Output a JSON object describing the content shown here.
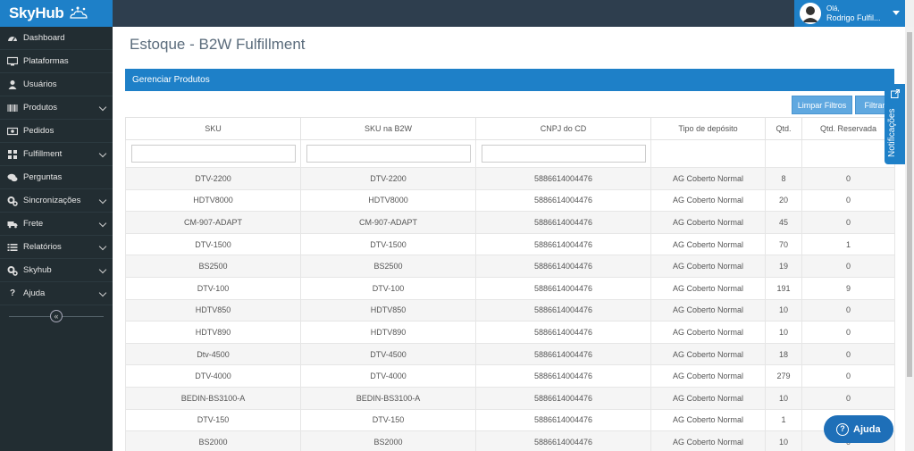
{
  "header": {
    "logo_text": "SkyHub",
    "user_greeting": "Olá,",
    "user_name": "Rodrigo Fulfil..."
  },
  "sidebar": {
    "items": [
      {
        "label": "Dashboard",
        "icon": "dashboard-icon",
        "has_submenu": false
      },
      {
        "label": "Plataformas",
        "icon": "monitor-icon",
        "has_submenu": false
      },
      {
        "label": "Usuários",
        "icon": "user-icon",
        "has_submenu": false
      },
      {
        "label": "Produtos",
        "icon": "barcode-icon",
        "has_submenu": true
      },
      {
        "label": "Pedidos",
        "icon": "money-icon",
        "has_submenu": false
      },
      {
        "label": "Fulfillment",
        "icon": "grid-icon",
        "has_submenu": true
      },
      {
        "label": "Perguntas",
        "icon": "comments-icon",
        "has_submenu": false
      },
      {
        "label": "Sincronizações",
        "icon": "cogs-icon",
        "has_submenu": true
      },
      {
        "label": "Frete",
        "icon": "truck-icon",
        "has_submenu": true
      },
      {
        "label": "Relatórios",
        "icon": "list-icon",
        "has_submenu": true
      },
      {
        "label": "Skyhub",
        "icon": "cogs-icon",
        "has_submenu": true
      },
      {
        "label": "Ajuda",
        "icon": "question-icon",
        "has_submenu": true
      }
    ]
  },
  "main": {
    "page_title": "Estoque - B2W Fulfillment",
    "panel_title": "Gerenciar Produtos",
    "buttons": {
      "clear_filters": "Limpar Filtros",
      "filter": "Filtrar"
    },
    "table": {
      "columns": [
        "SKU",
        "SKU na B2W",
        "CNPJ do CD",
        "Tipo de depósito",
        "Qtd.",
        "Qtd. Reservada"
      ],
      "rows": [
        [
          "DTV-2200",
          "DTV-2200",
          "5886614004476",
          "AG Coberto Normal",
          "8",
          "0"
        ],
        [
          "HDTV8000",
          "HDTV8000",
          "5886614004476",
          "AG Coberto Normal",
          "20",
          "0"
        ],
        [
          "CM-907-ADAPT",
          "CM-907-ADAPT",
          "5886614004476",
          "AG Coberto Normal",
          "45",
          "0"
        ],
        [
          "DTV-1500",
          "DTV-1500",
          "5886614004476",
          "AG Coberto Normal",
          "70",
          "1"
        ],
        [
          "BS2500",
          "BS2500",
          "5886614004476",
          "AG Coberto Normal",
          "19",
          "0"
        ],
        [
          "DTV-100",
          "DTV-100",
          "5886614004476",
          "AG Coberto Normal",
          "191",
          "9"
        ],
        [
          "HDTV850",
          "HDTV850",
          "5886614004476",
          "AG Coberto Normal",
          "10",
          "0"
        ],
        [
          "HDTV890",
          "HDTV890",
          "5886614004476",
          "AG Coberto Normal",
          "10",
          "0"
        ],
        [
          "Dtv-4500",
          "DTV-4500",
          "5886614004476",
          "AG Coberto Normal",
          "18",
          "0"
        ],
        [
          "DTV-4000",
          "DTV-4000",
          "5886614004476",
          "AG Coberto Normal",
          "279",
          "0"
        ],
        [
          "BEDIN-BS3100-A",
          "BEDIN-BS3100-A",
          "5886614004476",
          "AG Coberto Normal",
          "10",
          "0"
        ],
        [
          "DTV-150",
          "DTV-150",
          "5886614004476",
          "AG Coberto Normal",
          "1",
          ""
        ],
        [
          "BS2000",
          "BS2000",
          "5886614004476",
          "AG Coberto Normal",
          "10",
          "0"
        ]
      ]
    }
  },
  "notifications_tab": {
    "label": "Notificações"
  },
  "help_button": {
    "label": "Ajuda"
  },
  "colors": {
    "brand_blue": "#1e80c8",
    "sidebar_bg": "#222d32",
    "topbar_bg": "#2e3e4e",
    "button_light_blue": "#5fa8e0"
  }
}
